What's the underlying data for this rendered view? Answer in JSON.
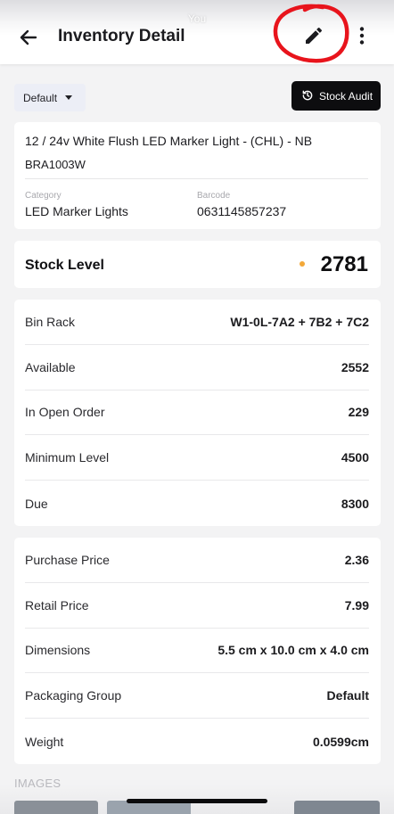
{
  "status_bar": {
    "caller_label": "You"
  },
  "header": {
    "title": "Inventory Detail",
    "back_icon": "arrow-left-icon",
    "edit_icon": "pencil-icon",
    "more_icon": "more-vertical-icon",
    "annotation_color": "#e8141c"
  },
  "toolbar": {
    "variant_selected": "Default",
    "stock_audit_label": "Stock Audit",
    "stock_audit_icon": "history-icon"
  },
  "product": {
    "name": "12 / 24v White Flush LED Marker Light - (CHL) - NB",
    "sku": "BRA1003W",
    "category_label": "Category",
    "category_value": "LED Marker Lights",
    "barcode_label": "Barcode",
    "barcode_value": "0631145857237"
  },
  "stock": {
    "label": "Stock Level",
    "value": "2781",
    "indicator_color": "#f3a838"
  },
  "inventory_rows": [
    {
      "label": "Bin Rack",
      "value": "W1-0L-7A2 + 7B2 + 7C2"
    },
    {
      "label": "Available",
      "value": "2552"
    },
    {
      "label": "In Open Order",
      "value": "229"
    },
    {
      "label": "Minimum Level",
      "value": "4500"
    },
    {
      "label": "Due",
      "value": "8300"
    }
  ],
  "pricing_rows": [
    {
      "label": "Purchase Price",
      "value": "2.36"
    },
    {
      "label": "Retail Price",
      "value": "7.99"
    },
    {
      "label": "Dimensions",
      "value": "5.5 cm x 10.0 cm x 4.0 cm"
    },
    {
      "label": "Packaging Group",
      "value": "Default"
    },
    {
      "label": "Weight",
      "value": "0.0599cm"
    }
  ],
  "images_section": {
    "label": "IMAGES"
  }
}
